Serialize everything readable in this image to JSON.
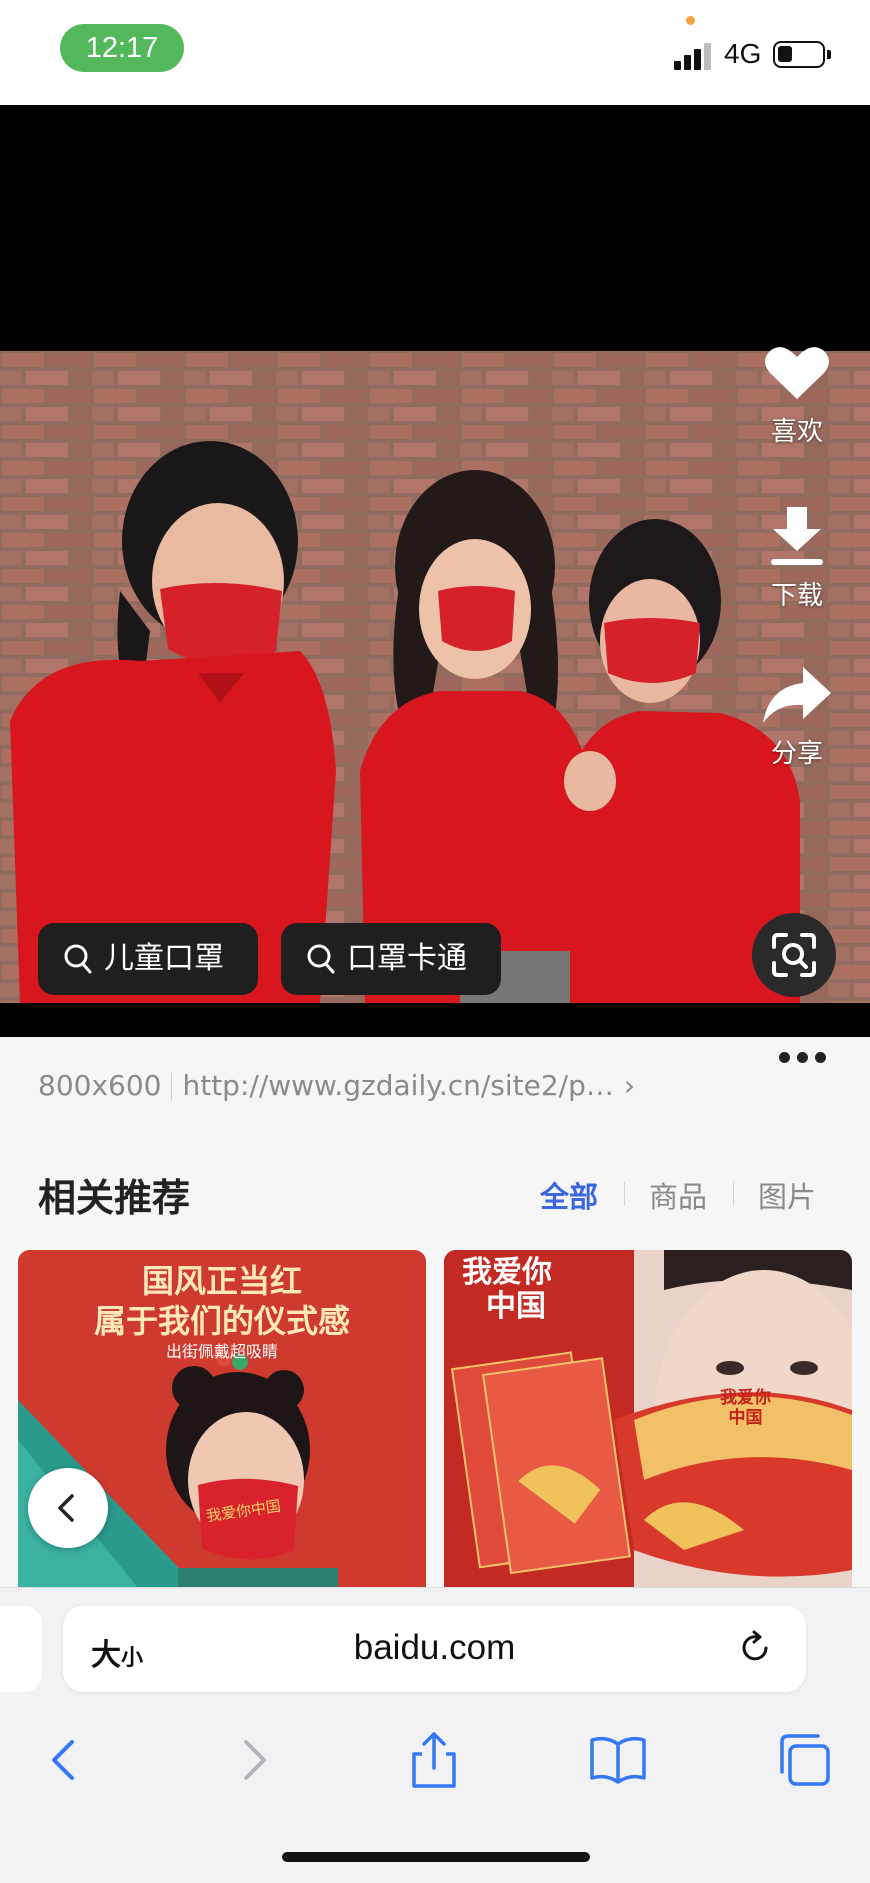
{
  "status_bar": {
    "time": "12:17",
    "network": "4G"
  },
  "viewer": {
    "side_actions": [
      {
        "icon": "heart-icon",
        "label": "喜欢"
      },
      {
        "icon": "download-icon",
        "label": "下载"
      },
      {
        "icon": "share-icon",
        "label": "分享"
      }
    ],
    "search_chips": [
      {
        "icon": "search-icon",
        "label": "儿童口罩"
      },
      {
        "icon": "search-icon",
        "label": "口罩卡通"
      }
    ],
    "scan_icon": "image-scan-icon"
  },
  "image_info": {
    "dimensions": "800x600",
    "source_url": "http://www.gzdaily.cn/site2/p…"
  },
  "related": {
    "title": "相关推荐",
    "filters": [
      {
        "label": "全部",
        "active": true
      },
      {
        "label": "商品",
        "active": false
      },
      {
        "label": "图片",
        "active": false
      }
    ],
    "cards": [
      {
        "headline_1": "国风正当红",
        "headline_2": "属于我们的仪式感",
        "subline": "出街佩戴超吸睛",
        "mask_text": "我爱你中国"
      },
      {
        "corner_text_1": "我爱你",
        "corner_text_2": "中国",
        "mask_text_1": "我爱你",
        "mask_text_2": "中国"
      }
    ]
  },
  "browser": {
    "text_size_label": "大",
    "text_size_small": "小",
    "domain": "baidu.com"
  },
  "colors": {
    "time_pill": "#53b85c",
    "accent_blue": "#3a66e0",
    "toolbar_blue": "#3478f6",
    "shirt_red": "#d8161d"
  }
}
